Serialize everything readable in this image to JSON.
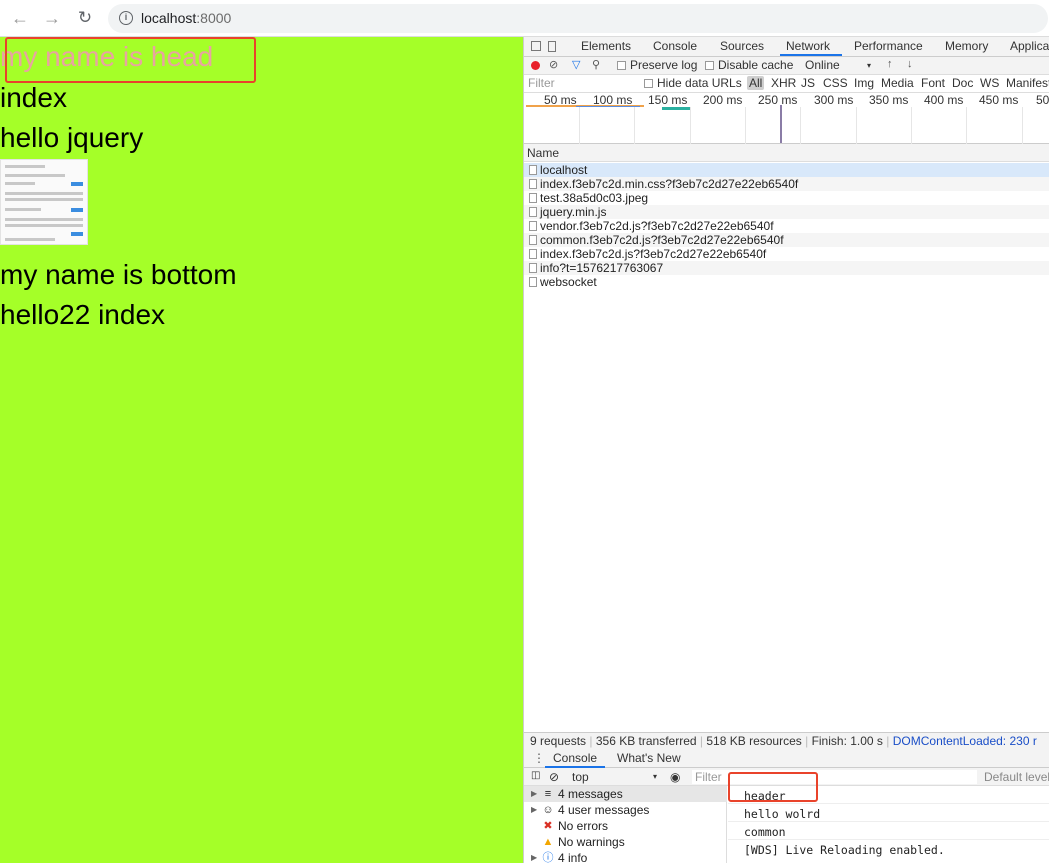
{
  "browser": {
    "url_host": "localhost",
    "url_port": ":8000"
  },
  "page": {
    "head_text": "my name is head",
    "index_text": "index",
    "jquery_text": "hello jquery",
    "bottom_text": "my name is bottom",
    "hello22_text": "hello22 index",
    "background": "#a5ff28",
    "highlight_color": "#e9432b"
  },
  "devtools": {
    "tabs": [
      "Elements",
      "Console",
      "Sources",
      "Network",
      "Performance",
      "Memory",
      "Applica"
    ],
    "active_tab": "Network",
    "toolbar": {
      "preserve_log": "Preserve log",
      "disable_cache": "Disable cache",
      "throttle": "Online"
    },
    "filter": {
      "placeholder": "Filter",
      "hide_data_urls": "Hide data URLs",
      "types": [
        "All",
        "XHR",
        "JS",
        "CSS",
        "Img",
        "Media",
        "Font",
        "Doc",
        "WS",
        "Manifest"
      ]
    },
    "timeline_labels": [
      "50 ms",
      "100 ms",
      "150 ms",
      "200 ms",
      "250 ms",
      "300 ms",
      "350 ms",
      "400 ms",
      "450 ms",
      "50"
    ],
    "name_header": "Name",
    "requests": [
      "localhost",
      "index.f3eb7c2d.min.css?f3eb7c2d27e22eb6540f",
      "test.38a5d0c03.jpeg",
      "jquery.min.js",
      "vendor.f3eb7c2d.js?f3eb7c2d27e22eb6540f",
      "common.f3eb7c2d.js?f3eb7c2d27e22eb6540f",
      "index.f3eb7c2d.js?f3eb7c2d27e22eb6540f",
      "info?t=1576217763067",
      "websocket"
    ],
    "status": {
      "requests": "9 requests",
      "transferred": "356 KB transferred",
      "resources": "518 KB resources",
      "finish": "Finish: 1.00 s",
      "dom_loaded": "DOMContentLoaded: 230 r"
    },
    "drawer": {
      "tabs": [
        "Console",
        "What's New"
      ],
      "context": "top",
      "filter_placeholder": "Filter",
      "levels": "Default level"
    },
    "console_sidebar": [
      {
        "icon": "list-icon",
        "label": "4 messages"
      },
      {
        "icon": "user-icon",
        "label": "4 user messages"
      },
      {
        "icon": "error-icon",
        "label": "No errors"
      },
      {
        "icon": "warning-icon",
        "label": "No warnings"
      },
      {
        "icon": "info-icon",
        "label": "4 info"
      }
    ],
    "console_logs": [
      "header",
      "hello wolrd",
      "common",
      "[WDS] Live Reloading enabled."
    ]
  }
}
